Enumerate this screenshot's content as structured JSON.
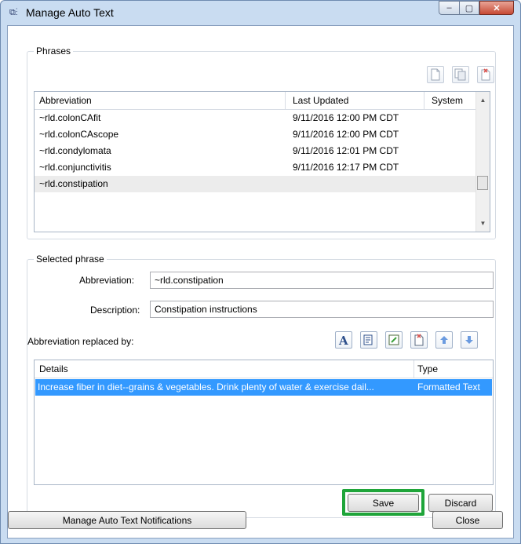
{
  "window": {
    "title": "Manage Auto Text",
    "app_icon": "⧉⁝",
    "min_glyph": "–",
    "max_glyph": "▢",
    "close_glyph": "✕"
  },
  "phrases": {
    "legend": "Phrases",
    "toolbar": {
      "icons": [
        "new-phrase-icon",
        "copy-phrase-icon",
        "delete-phrase-icon"
      ]
    },
    "columns": [
      "Abbreviation",
      "Last Updated",
      "System"
    ],
    "rows": [
      {
        "abbreviation": "~rld.colonCAfit",
        "last_updated": "9/11/2016 12:00 PM CDT",
        "system": ""
      },
      {
        "abbreviation": "~rld.colonCAscope",
        "last_updated": "9/11/2016 12:00 PM CDT",
        "system": ""
      },
      {
        "abbreviation": "~rld.condylomata",
        "last_updated": "9/11/2016 12:01 PM CDT",
        "system": ""
      },
      {
        "abbreviation": "~rld.conjunctivitis",
        "last_updated": "9/11/2016 12:17 PM CDT",
        "system": ""
      },
      {
        "abbreviation": "~rld.constipation",
        "last_updated": "",
        "system": ""
      }
    ],
    "selected_index": 4
  },
  "selected_phrase": {
    "legend": "Selected phrase",
    "abbreviation_label": "Abbreviation:",
    "abbreviation_value": "~rld.constipation",
    "description_label": "Description:",
    "description_value": "Constipation instructions",
    "replaced_by_label": "Abbreviation replaced by:",
    "toolbar_icons": [
      "formatted-text-icon",
      "template-icon",
      "edit-icon",
      "delete-icon",
      "move-up-icon",
      "move-down-icon"
    ],
    "columns": [
      "Details",
      "Type"
    ],
    "rows": [
      {
        "details": "Increase fiber in diet--grains & vegetables. Drink plenty of water & exercise dail...",
        "type": "Formatted Text"
      }
    ],
    "save_label": "Save",
    "discard_label": "Discard"
  },
  "footer": {
    "notifications_label": "Manage Auto Text Notifications",
    "close_label": "Close"
  },
  "colors": {
    "selection_blue": "#3399ff",
    "highlight_green": "#1fa53a",
    "title_bar": "#c9dcf1"
  }
}
